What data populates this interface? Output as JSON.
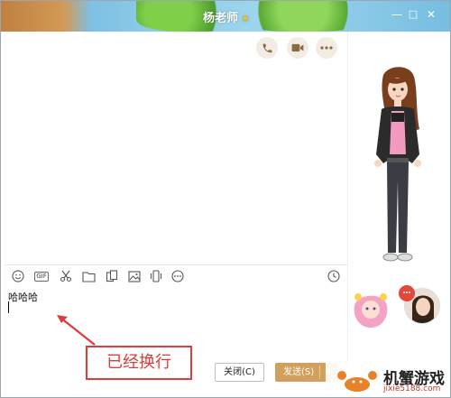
{
  "window": {
    "title": "杨老师",
    "title_star": "★",
    "minimize_label": "—",
    "maximize_label": "□",
    "close_label": "✕"
  },
  "chat_header": {
    "phone_icon": "phone-icon",
    "video_icon": "video-icon",
    "more_icon": "more-icon"
  },
  "toolbar": {
    "icons": [
      "emoji-icon",
      "gif-icon",
      "scissors-icon",
      "folder-icon",
      "file-transfer-icon",
      "image-icon",
      "shake-icon",
      "more-icon",
      "history-icon"
    ],
    "gif_label": "GIF"
  },
  "input": {
    "value": "哈哈哈"
  },
  "annotation": {
    "text": "已经换行",
    "color": "#e03b3b"
  },
  "buttons": {
    "close_label": "关闭(C)",
    "send_label": "发送(S)",
    "send_dropdown": "⌄"
  },
  "colors": {
    "send_button": "#d2a05d",
    "badge": "#e2493b"
  },
  "watermark": {
    "title": "机蟹游戏",
    "url": "jixie5188.com"
  }
}
